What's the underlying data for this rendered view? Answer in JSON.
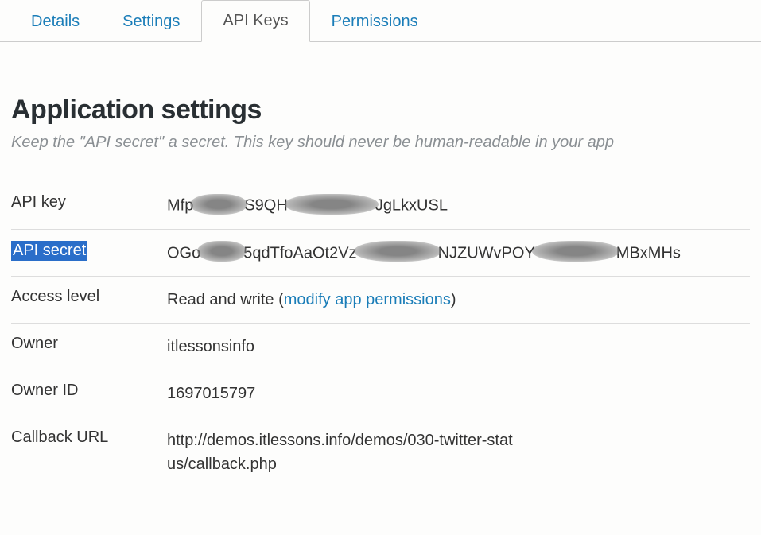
{
  "tabs": {
    "details": "Details",
    "settings": "Settings",
    "api_keys": "API Keys",
    "permissions": "Permissions",
    "active": "api_keys"
  },
  "section": {
    "heading": "Application settings",
    "subtext": "Keep the \"API secret\" a secret. This key should never be human-readable in your app"
  },
  "rows": {
    "api_key": {
      "label": "API key",
      "value_parts": [
        "Mfp",
        "S9QH",
        "JgLkxUSL"
      ]
    },
    "api_secret": {
      "label": "API secret",
      "value_parts": [
        "OGo",
        "5qdTfoAaOt2Vz",
        "NJZUWvPOY",
        "MBxMHs"
      ]
    },
    "access_level": {
      "label": "Access level",
      "value": "Read and write",
      "link_text": "modify app permissions"
    },
    "owner": {
      "label": "Owner",
      "value": "itlessonsinfo"
    },
    "owner_id": {
      "label": "Owner ID",
      "value": "1697015797"
    },
    "callback_url": {
      "label": "Callback URL",
      "value": "http://demos.itlessons.info/demos/030-twitter-status/callback.php"
    }
  }
}
